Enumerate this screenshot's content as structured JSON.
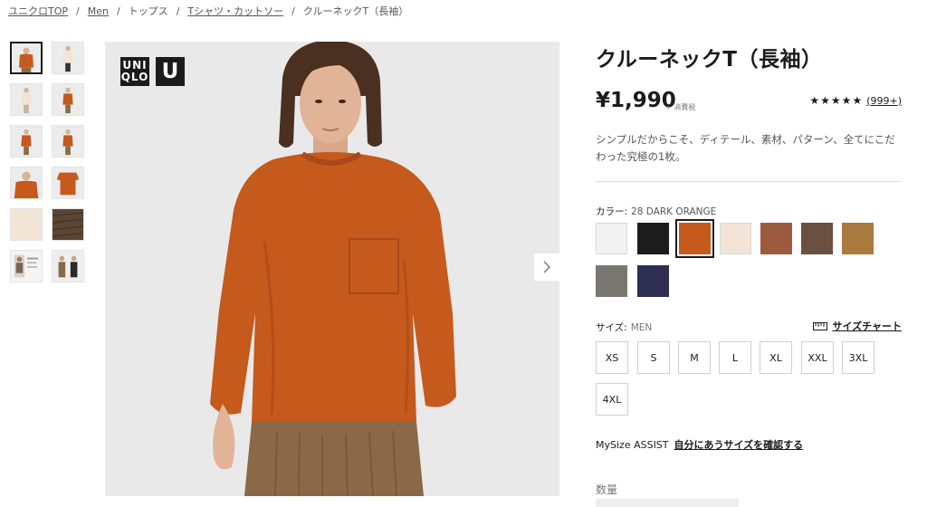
{
  "breadcrumb": [
    {
      "label": "ユニクロTOP",
      "link": true
    },
    {
      "label": "Men",
      "link": true
    },
    {
      "label": "トップス",
      "link": false
    },
    {
      "label": "Tシャツ・カットソー",
      "link": true
    },
    {
      "label": "クルーネックT（長袖）",
      "link": false
    }
  ],
  "breadcrumb_separator": "/",
  "gallery": {
    "logo_uniqlo": "UNI QLO",
    "logo_u": "U",
    "next_icon": "chevron-right-icon",
    "thumbnail_count": 12,
    "selected_index": 0
  },
  "product": {
    "title": "クルーネックT（長袖）",
    "price": "¥1,990",
    "tax_note": "+ 消費税",
    "stars": "★★★★★",
    "rating_value": 4.5,
    "review_count": "(999+)",
    "description": "シンプルだからこそ、ディテール、素材、パターン、全てにこだわった究極の1枚。"
  },
  "color": {
    "label": "カラー:",
    "selected": "28 DARK ORANGE",
    "swatches": [
      {
        "name": "white",
        "hex": "#f2f2f2"
      },
      {
        "name": "black",
        "hex": "#1c1c1c"
      },
      {
        "name": "dark-orange",
        "hex": "#c55a1c",
        "selected": true
      },
      {
        "name": "natural",
        "hex": "#f2e4d6"
      },
      {
        "name": "brown",
        "hex": "#9c5a3e"
      },
      {
        "name": "dark-brown",
        "hex": "#6a5040"
      },
      {
        "name": "camel",
        "hex": "#a87a3e"
      },
      {
        "name": "gray",
        "hex": "#7a7672"
      },
      {
        "name": "navy",
        "hex": "#2e2f52"
      }
    ]
  },
  "size": {
    "label": "サイズ:",
    "category": "MEN",
    "chart_label": "サイズチャート",
    "chart_icon": "ruler-icon",
    "options": [
      "XS",
      "S",
      "M",
      "L",
      "XL",
      "XXL",
      "3XL",
      "4XL"
    ]
  },
  "mysize": {
    "label": "MySize ASSIST",
    "link": "自分にあうサイズを確認する"
  },
  "quantity": {
    "label": "数量"
  },
  "colors": {
    "accent": "#1b1b1b",
    "tshirt": "#c55a1c",
    "background": "#e9e9e9"
  }
}
